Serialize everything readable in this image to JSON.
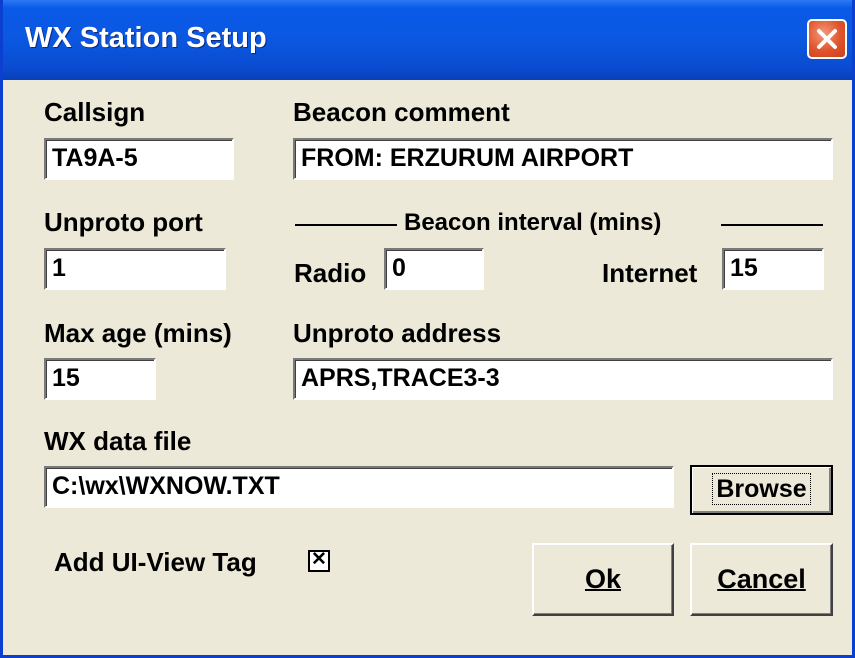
{
  "window": {
    "title": "WX Station Setup"
  },
  "callsign": {
    "label": "Callsign",
    "value": "TA9A-5"
  },
  "beacon_comment": {
    "label": "Beacon comment",
    "value": "FROM: ERZURUM AIRPORT"
  },
  "unproto_port": {
    "label": "Unproto port",
    "value": "1"
  },
  "beacon_interval": {
    "label": "Beacon interval (mins)",
    "radio_label": "Radio",
    "radio_value": "0",
    "internet_label": "Internet",
    "internet_value": "15"
  },
  "max_age": {
    "label": "Max age (mins)",
    "value": "15"
  },
  "unproto_address": {
    "label": "Unproto address",
    "value": "APRS,TRACE3-3"
  },
  "wx_data_file": {
    "label": "WX data file",
    "value": "C:\\wx\\WXNOW.TXT",
    "browse_label": "Browse"
  },
  "ui_view_tag": {
    "label": "Add UI-View Tag",
    "checked": true,
    "mark": "✕"
  },
  "buttons": {
    "ok_label": "Ok",
    "cancel_label": "Cancel"
  }
}
